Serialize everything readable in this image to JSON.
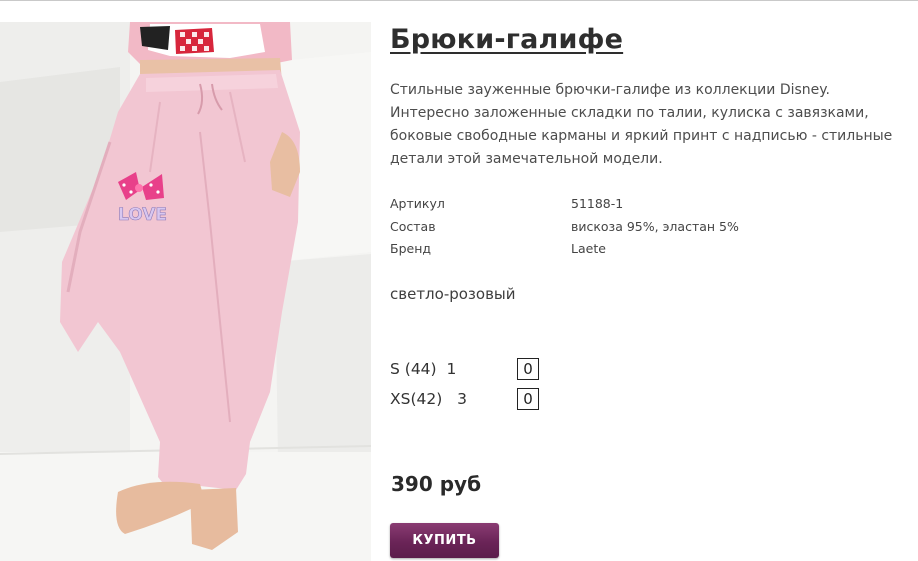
{
  "product": {
    "title": "Брюки-галифе",
    "description": "Стильные зауженные брючки-галифе из коллекции Disney. Интересно заложенные складки по талии, кулиска с завязками, боковые свободные карманы и яркий принт с надписью - стильные детали этой замечательной модели.",
    "print_text": "LOVE",
    "specs": [
      {
        "label": "Артикул",
        "value": "51188-1"
      },
      {
        "label": "Состав",
        "value": "вискоза 95%, эластан 5%"
      },
      {
        "label": "Бренд",
        "value": "Laete"
      }
    ],
    "color_name": "светло-розовый",
    "sizes": [
      {
        "size": "S (44)",
        "stock": "1",
        "quantity": "0"
      },
      {
        "size": "XS(42)",
        "stock": "3",
        "quantity": "0"
      }
    ],
    "price": "390 руб",
    "buy_label": "КУПИТЬ"
  },
  "colors": {
    "pants": "#f2c6d2",
    "buy_button": "#6a2457",
    "title": "#2e2e2e"
  }
}
